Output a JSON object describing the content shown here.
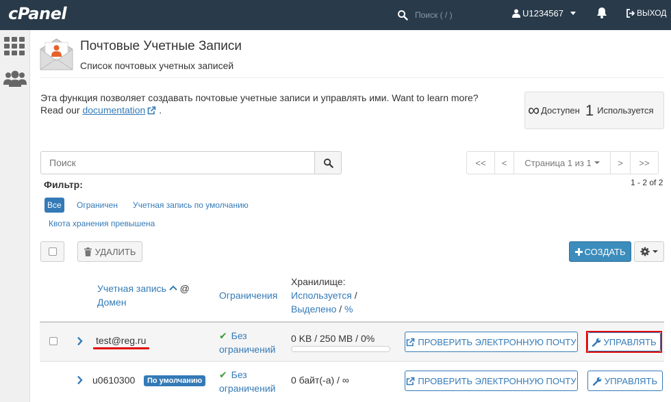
{
  "topbar": {
    "logo": "cPanel",
    "search_placeholder": "Поиск ( / )",
    "username": "U1234567",
    "logout_label": "ВЫХОД"
  },
  "header": {
    "title": "Почтовые Учетные Записи",
    "subtitle": "Список почтовых учетных записей"
  },
  "description": {
    "text": "Эта функция позволяет создавать почтовые учетные записи и управлять ими. Want to learn more?",
    "read_our": "Read our ",
    "link": "documentation",
    "period": "."
  },
  "stats": {
    "available_symbol": "∞",
    "available_label": "Доступен",
    "used_count": "1",
    "used_label": "Используется"
  },
  "search": {
    "placeholder": "Поиск"
  },
  "pager": {
    "first": "<<",
    "prev": "<",
    "page_label": "Страница 1 из 1",
    "next": ">",
    "last": ">>",
    "count": "1 - 2 of 2"
  },
  "filter": {
    "label": "Фильтр:",
    "options": [
      "Все",
      "Ограничен",
      "Учетная запись по умолчанию",
      "Квота хранения превышена"
    ]
  },
  "toolbar": {
    "delete_label": "УДАЛИТЬ",
    "create_label": "СОЗДАТЬ"
  },
  "table": {
    "col_account": "Учетная запись",
    "col_at": "@",
    "col_domain": "Домен",
    "col_restrictions": "Ограничения",
    "col_storage": "Хранилище:",
    "col_used": "Используется",
    "col_slash1": "/",
    "col_allocated": "Выделено",
    "col_slash2": "/",
    "col_percent": "%",
    "rows": [
      {
        "account": "test@reg.ru",
        "restriction_line1": "Без",
        "restriction_line2": "ограничений",
        "storage": "0 KB / 250 MB / 0%",
        "usage_fraction": 0,
        "check_label": "ПРОВЕРИТЬ ЭЛЕКТРОННУЮ ПОЧТУ",
        "manage_label": "УПРАВЛЯТЬ"
      },
      {
        "account": "u0610300",
        "badge": "По умолчанию",
        "restriction_line1": "Без",
        "restriction_line2": "ограничений",
        "storage": "0 байт(-а) / ∞",
        "check_label": "ПРОВЕРИТЬ ЭЛЕКТРОННУЮ ПОЧТУ",
        "manage_label": "УПРАВЛЯТЬ"
      }
    ]
  }
}
